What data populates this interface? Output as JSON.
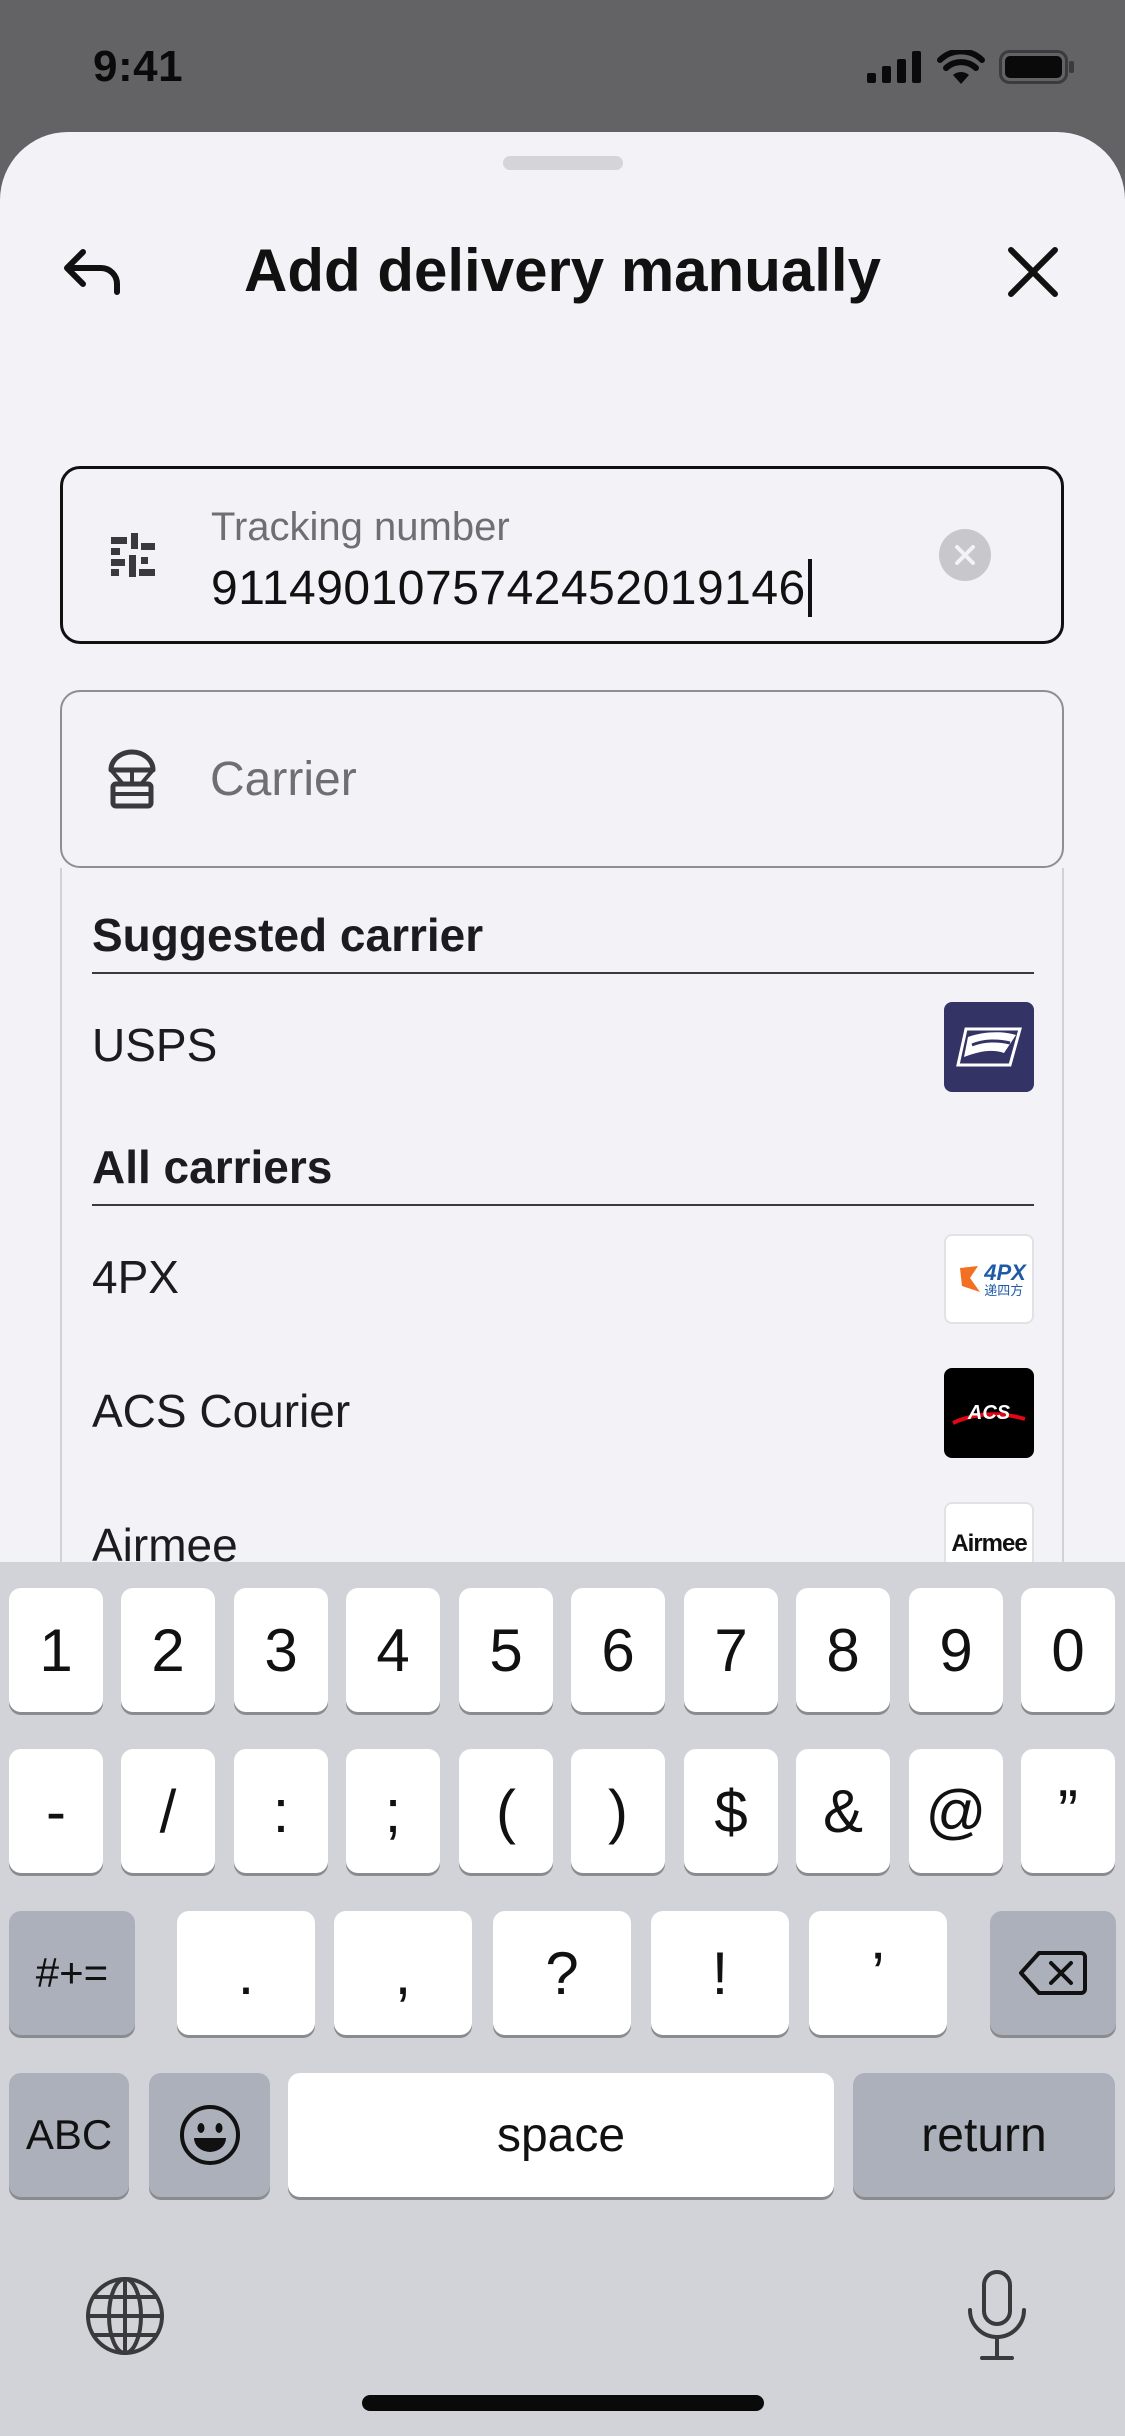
{
  "status_bar": {
    "time": "9:41"
  },
  "header": {
    "title": "Add delivery manually"
  },
  "tracking": {
    "label": "Tracking number",
    "value": "9114901075742452019146"
  },
  "carrier": {
    "placeholder": "Carrier"
  },
  "suggested": {
    "title": "Suggested carrier",
    "items": [
      {
        "name": "USPS",
        "logo": "usps-logo"
      }
    ]
  },
  "all_carriers": {
    "title": "All carriers",
    "items": [
      {
        "name": "4PX",
        "logo": "4px-logo",
        "logo_text": "4PX",
        "logo_subtext": "递四方"
      },
      {
        "name": "ACS Courier",
        "logo": "acs-logo",
        "logo_text": "ACS"
      },
      {
        "name": "Airmee",
        "logo": "airmee-logo",
        "logo_text": "Airmee"
      }
    ]
  },
  "keyboard": {
    "row1": [
      "1",
      "2",
      "3",
      "4",
      "5",
      "6",
      "7",
      "8",
      "9",
      "0"
    ],
    "row2": [
      "-",
      "/",
      ":",
      ";",
      "(",
      ")",
      "$",
      "&",
      "@",
      "”"
    ],
    "row3": {
      "mode": "#+=",
      "keys": [
        ".",
        ",",
        "?",
        "!",
        "’"
      ]
    },
    "row4": {
      "abc": "ABC",
      "space": "space",
      "return": "return"
    }
  },
  "colors": {
    "sheet_bg": "#f2f2f7",
    "keyboard_bg": "#d1d3d9",
    "usps_blue": "#333366",
    "acs_black": "#000000",
    "px_orange": "#f36f21",
    "px_blue": "#1f5aa6"
  }
}
